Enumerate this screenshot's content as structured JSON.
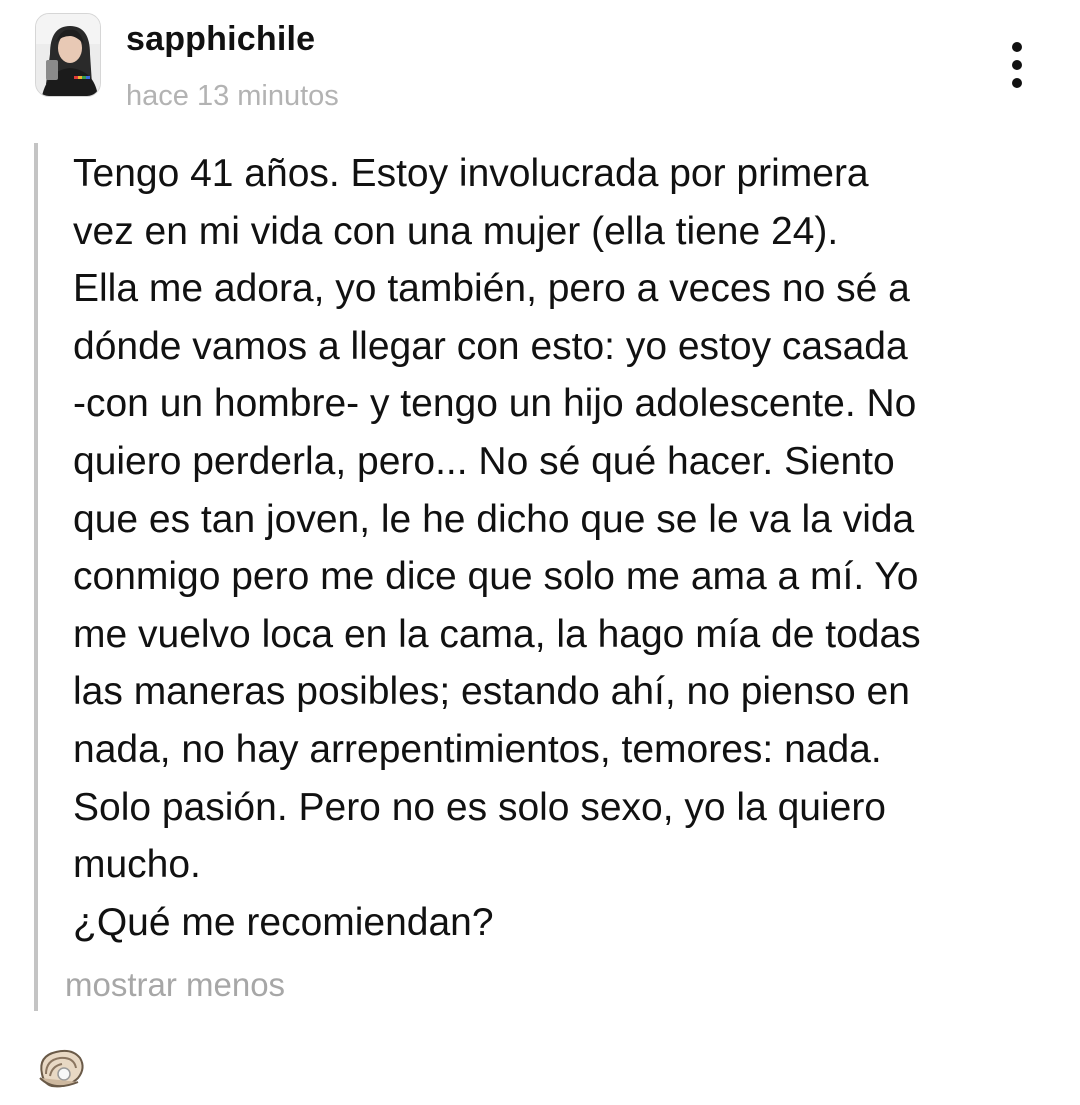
{
  "post": {
    "author": {
      "username": "sapphichile",
      "avatar_icon": "profile-photo"
    },
    "timestamp": "hace 13 minutos",
    "more_icon": "vertical-ellipsis-icon",
    "text": "Tengo 41 años. Estoy involucrada por primera\nvez en mi vida con una mujer (ella tiene 24).\nElla me adora, yo también, pero a veces no sé a\ndónde vamos a llegar con esto: yo estoy casada\n-con un hombre- y tengo un hijo adolescente. No\nquiero perderla, pero... No sé qué hacer. Siento\nque es tan joven, le he dicho que se le va la vida\nconmigo pero me dice que solo me ama a mí. Yo\nme vuelvo loca en la cama, la hago mía de todas\nlas maneras posibles; estando ahí, no pienso en\nnada, no hay arrepentimientos, temores: nada.\nSolo pasión. Pero no es solo sexo, yo la quiero\nmucho.\n¿Qué me recomiendan?",
    "show_less_label": "mostrar menos",
    "reaction_icon": "oyster-icon"
  },
  "colors": {
    "text": "#111111",
    "muted": "#b3b3b3",
    "quote_bar": "#c4c4c4"
  }
}
